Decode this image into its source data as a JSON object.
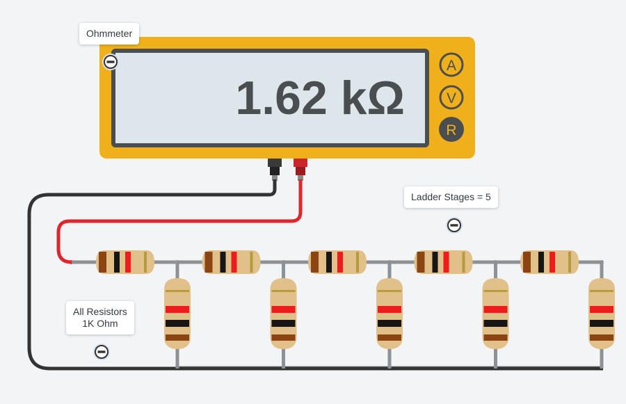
{
  "meter": {
    "label": "Ohmmeter",
    "reading": "1.62 kΩ",
    "mode_buttons": [
      {
        "label": "A",
        "active": false
      },
      {
        "label": "V",
        "active": false
      },
      {
        "label": "R",
        "active": true
      }
    ]
  },
  "ladder": {
    "stages_label": "Ladder Stages = 5",
    "stages": 5
  },
  "resistors": {
    "label_line1": "All Resistors",
    "label_line2": "1K Ohm"
  },
  "colors": {
    "meter_body": "#f0b01c",
    "meter_frame": "#4a4e50",
    "display": "#dde6eb",
    "reading_text": "#4a4e50",
    "probe_red": "#e0262a",
    "probe_black": "#333333",
    "wire": "#8d9296",
    "resistor_body": "#e2c08a",
    "band_brown": "#8b4513",
    "band_black": "#161616",
    "band_red": "#ee1c1c",
    "band_gold": "#b89a3e",
    "ring": "#d4e1ea"
  },
  "icons": {
    "collapse": "minus-circle-icon"
  }
}
